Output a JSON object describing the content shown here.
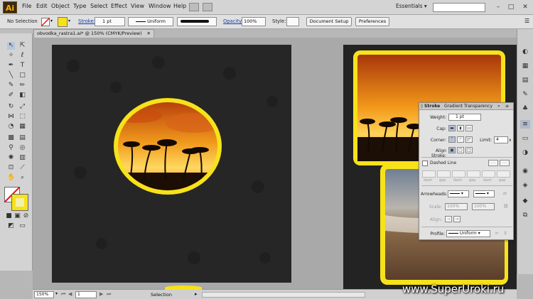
{
  "app": {
    "logo": "Ai",
    "workspace": "Essentials ▾"
  },
  "menu": [
    "File",
    "Edit",
    "Object",
    "Type",
    "Select",
    "Effect",
    "View",
    "Window",
    "Help"
  ],
  "window_controls": [
    "–",
    "□",
    "✕"
  ],
  "control_bar": {
    "selection_label": "No Selection",
    "stroke_label": "Stroke:",
    "stroke_weight": "1 pt",
    "profile_value": "Uniform",
    "opacity_label": "Opacity:",
    "opacity_value": "100%",
    "style_label": "Style:",
    "document_setup": "Document Setup",
    "preferences": "Preferences"
  },
  "document_tab": {
    "title": "obvodka_rastra1.ai* @ 150% (CMYK/Preview)",
    "close": "✕"
  },
  "stroke_panel": {
    "tabs": [
      "◊ Stroke",
      "Gradient",
      "Transparency"
    ],
    "weight_label": "Weight:",
    "weight_value": "1 pt",
    "cap_label": "Cap:",
    "corner_label": "Corner:",
    "limit_label": "Limit:",
    "limit_value": "4",
    "limit_unit": "x",
    "align_label": "Align Stroke:",
    "dashed_label": "Dashed Line",
    "dash_cells": [
      "dash",
      "gap",
      "dash",
      "gap",
      "dash",
      "gap"
    ],
    "arrowheads_label": "Arrowheads:",
    "scale_label": "Scale:",
    "scale_1": "100%",
    "scale_2": "100%",
    "align_arrow_label": "Align:",
    "profile_label": "Profile:",
    "profile_value": "Uniform"
  },
  "status_bar": {
    "zoom": "150%",
    "artboard_number": "1",
    "status_text": "Selection"
  },
  "watermark": "www.SuperUroki.ru",
  "colors": {
    "accent_yellow": "#f7e21a",
    "artboard_dark": "#262626",
    "sunset_orange": "#ef7d12"
  }
}
